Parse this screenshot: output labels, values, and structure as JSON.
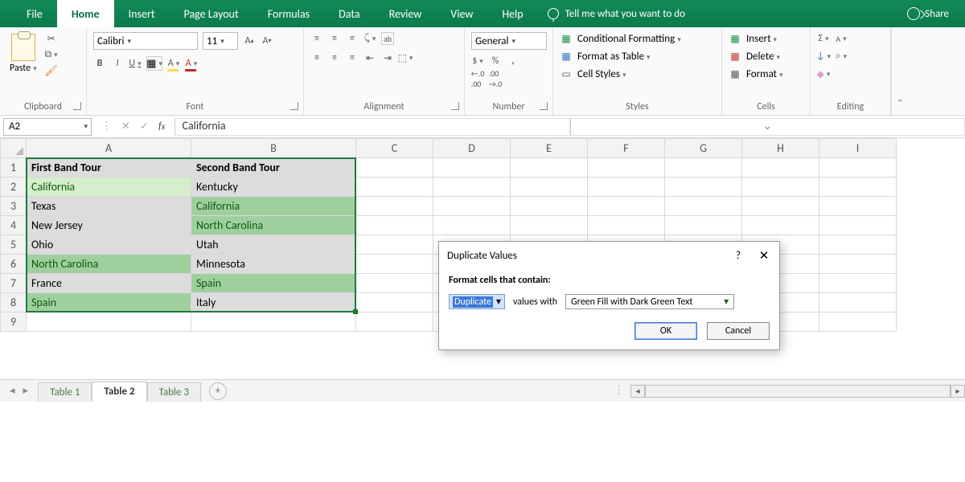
{
  "tabs": {
    "file": "File",
    "home": "Home",
    "insert": "Insert",
    "page_layout": "Page Layout",
    "formulas": "Formulas",
    "data": "Data",
    "review": "Review",
    "view": "View",
    "help": "Help",
    "tell_me": "Tell me what you want to do",
    "share": "Share"
  },
  "ribbon": {
    "clipboard": {
      "paste": "Paste",
      "label": "Clipboard"
    },
    "font": {
      "name": "Calibri",
      "size": "11",
      "bold": "B",
      "italic": "I",
      "underline": "U",
      "label": "Font"
    },
    "alignment": {
      "label": "Alignment",
      "wrap": "ab"
    },
    "number": {
      "format": "General",
      "currency": "$",
      "percent": "%",
      "comma": ",",
      "dec_inc": ".0",
      "dec_dec": ".00",
      "label": "Number"
    },
    "styles": {
      "cond": "Conditional Formatting",
      "table": "Format as Table",
      "cell": "Cell Styles",
      "label": "Styles"
    },
    "cells": {
      "insert": "Insert",
      "delete": "Delete",
      "format": "Format",
      "label": "Cells"
    },
    "editing": {
      "label": "Editing"
    }
  },
  "formula_bar": {
    "name_box": "A2",
    "value": "California",
    "cancel": "✕",
    "enter": "✓"
  },
  "columns": [
    "A",
    "B",
    "C",
    "D",
    "E",
    "F",
    "G",
    "H",
    "I"
  ],
  "rows": [
    "1",
    "2",
    "3",
    "4",
    "5",
    "6",
    "7",
    "8",
    "9"
  ],
  "table": {
    "headers": {
      "a": "First Band Tour",
      "b": "Second Band Tour"
    },
    "data": [
      {
        "a": "California",
        "b": "Kentucky",
        "a_dup": true,
        "b_dup": false
      },
      {
        "a": "Texas",
        "b": "California",
        "a_dup": false,
        "b_dup": true
      },
      {
        "a": "New Jersey",
        "b": "North Carolina",
        "a_dup": false,
        "b_dup": true
      },
      {
        "a": "Ohio",
        "b": "Utah",
        "a_dup": false,
        "b_dup": false
      },
      {
        "a": "North Carolina",
        "b": "Minnesota",
        "a_dup": true,
        "b_dup": false
      },
      {
        "a": "France",
        "b": "Spain",
        "a_dup": false,
        "b_dup": true
      },
      {
        "a": "Spain",
        "b": "Italy",
        "a_dup": true,
        "b_dup": false
      }
    ]
  },
  "sheets": {
    "t1": "Table 1",
    "t2": "Table 2",
    "t3": "Table 3"
  },
  "dialog": {
    "title": "Duplicate Values",
    "help": "?",
    "instruction": "Format cells that contain:",
    "mode": "Duplicate",
    "values_with": "values with",
    "format": "Green Fill with Dark Green Text",
    "ok": "OK",
    "cancel": "Cancel"
  }
}
